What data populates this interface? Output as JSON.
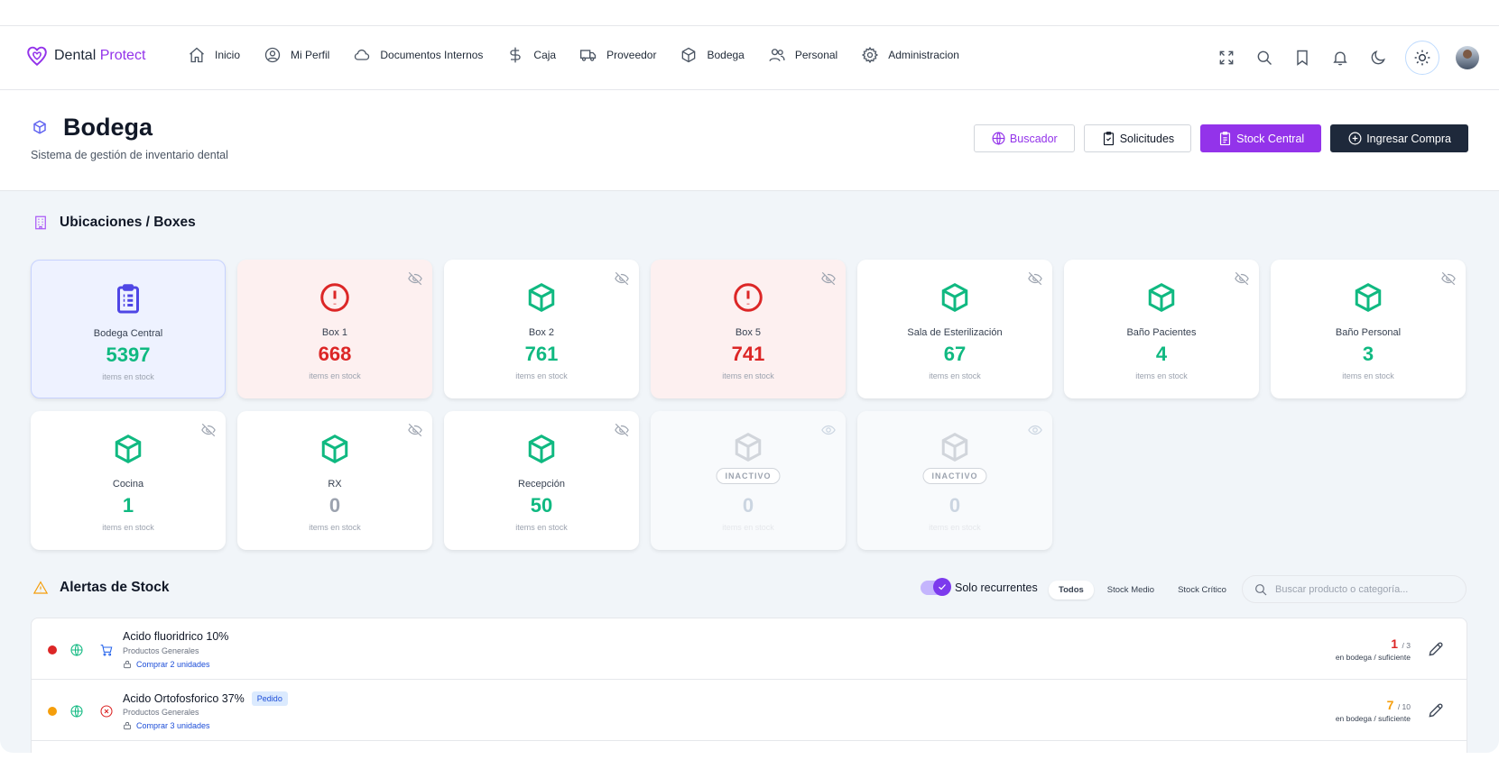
{
  "brand": {
    "name_part1": "Dental ",
    "name_part2": "Protect",
    "accent": "#9333ea"
  },
  "nav": {
    "items": [
      {
        "label": "Inicio",
        "icon": "home-icon"
      },
      {
        "label": "Mi Perfil",
        "icon": "user-circle-icon"
      },
      {
        "label": "Documentos Internos",
        "icon": "cloud-icon"
      },
      {
        "label": "Caja",
        "icon": "dollar-icon"
      },
      {
        "label": "Proveedor",
        "icon": "truck-icon"
      },
      {
        "label": "Bodega",
        "icon": "box-icon"
      },
      {
        "label": "Personal",
        "icon": "users-icon"
      },
      {
        "label": "Administracion",
        "icon": "gear-icon"
      }
    ],
    "right_icons": [
      "fullscreen-icon",
      "search-icon",
      "bookmark-icon",
      "bell-icon",
      "moon-icon",
      "sun-icon",
      "avatar"
    ]
  },
  "header": {
    "title": "Bodega",
    "subtitle": "Sistema de gestión de inventario dental",
    "actions": {
      "buscador": "Buscador",
      "solicitudes": "Solicitudes",
      "stock_central": "Stock Central",
      "ingresar_compra": "Ingresar Compra"
    }
  },
  "locations": {
    "title": "Ubicaciones / Boxes",
    "unit_label": "items en stock",
    "inactive_label": "INACTIVO",
    "cards": [
      {
        "name": "Bodega Central",
        "value": "5397",
        "status": "central"
      },
      {
        "name": "Box 1",
        "value": "668",
        "status": "alert"
      },
      {
        "name": "Box 2",
        "value": "761",
        "status": "ok"
      },
      {
        "name": "Box 5",
        "value": "741",
        "status": "alert"
      },
      {
        "name": "Sala de Esterilización",
        "value": "67",
        "status": "ok"
      },
      {
        "name": "Baño Pacientes",
        "value": "4",
        "status": "ok"
      },
      {
        "name": "Baño Personal",
        "value": "3",
        "status": "ok"
      },
      {
        "name": "Cocina",
        "value": "1",
        "status": "ok"
      },
      {
        "name": "RX",
        "value": "0",
        "status": "empty"
      },
      {
        "name": "Recepción",
        "value": "50",
        "status": "ok"
      },
      {
        "name": "",
        "value": "0",
        "status": "inactive"
      },
      {
        "name": "",
        "value": "0",
        "status": "inactive"
      }
    ]
  },
  "alerts": {
    "title": "Alertas de Stock",
    "toggle_label": "Solo recurrentes",
    "toggle_on": true,
    "filters": [
      "Todos",
      "Stock Medio",
      "Stock Crítico"
    ],
    "active_filter": "Todos",
    "search_placeholder": "Buscar producto o categoría...",
    "qty_label": "en bodega / suficiente",
    "rows": [
      {
        "name": "Acido fluoridrico 10%",
        "category": "Productos Generales",
        "buy": "Comprar 2 unidades",
        "badge": "",
        "current": "1",
        "target": "/ 3",
        "severity_color": "#dc2626",
        "status_icon": "cart-icon"
      },
      {
        "name": "Acido Ortofosforico 37%",
        "category": "Productos Generales",
        "buy": "Comprar 3 unidades",
        "badge": "Pedido",
        "current": "7",
        "target": "/ 10",
        "severity_color": "#f59e0b",
        "status_icon": "x-circle-icon"
      }
    ]
  }
}
